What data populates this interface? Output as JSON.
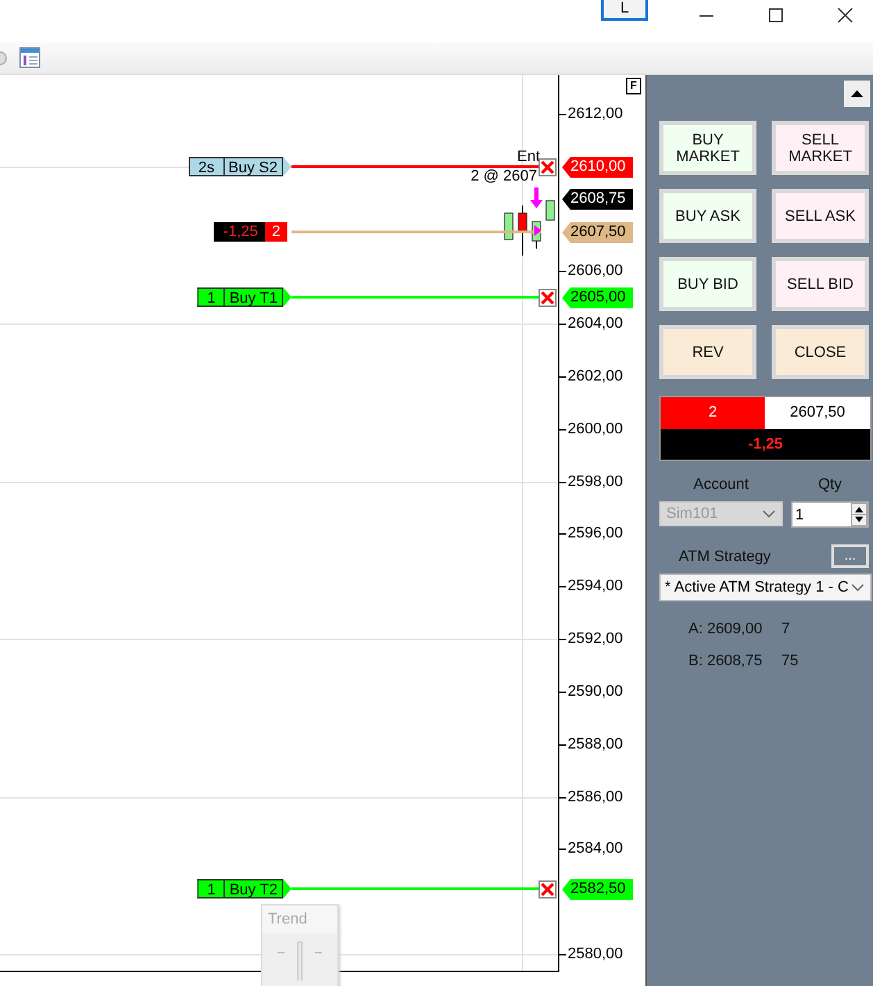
{
  "title_bar": {
    "badge": "L"
  },
  "chart": {
    "flag": "F",
    "price_axis": [
      "2612,00",
      "2606,00",
      "2604,00",
      "2602,00",
      "2600,00",
      "2598,00",
      "2596,00",
      "2594,00",
      "2592,00",
      "2590,00",
      "2588,00",
      "2586,00",
      "2584,00",
      "2580,00"
    ],
    "orders": [
      {
        "kind": "stop",
        "quantity": "2s",
        "label": "Buy S2",
        "price": "2610,00"
      },
      {
        "kind": "target",
        "quantity": "1",
        "label": "Buy T1",
        "price": "2605,00"
      },
      {
        "kind": "target",
        "quantity": "1",
        "label": "Buy T2",
        "price": "2582,50"
      }
    ],
    "entry_marker": {
      "title": "Ent",
      "detail": "2 @ 2607"
    },
    "last_price": "2608,75",
    "position": {
      "pnl": "-1,25",
      "quantity": "2",
      "price": "2607,50"
    },
    "trend_panel": {
      "title": "Trend"
    }
  },
  "panel": {
    "buttons": [
      {
        "kind": "buy",
        "label": "BUY MARKET"
      },
      {
        "kind": "sell",
        "label": "SELL MARKET"
      },
      {
        "kind": "buy",
        "label": "BUY ASK"
      },
      {
        "kind": "sell",
        "label": "SELL ASK"
      },
      {
        "kind": "buy",
        "label": "BUY BID"
      },
      {
        "kind": "sell",
        "label": "SELL BID"
      },
      {
        "kind": "neutral",
        "label": "REV"
      },
      {
        "kind": "neutral",
        "label": "CLOSE"
      }
    ],
    "position": {
      "quantity": "2",
      "avg_price": "2607,50",
      "pnl": "-1,25"
    },
    "account": {
      "label": "Account",
      "value": "Sim101",
      "disabled": true
    },
    "qty": {
      "label": "Qty",
      "value": "1"
    },
    "atm": {
      "label": "ATM Strategy",
      "button": "...",
      "value": "* Active ATM Strategy 1 - C"
    },
    "quotes": [
      {
        "label": "A: 2609,00",
        "size": "7"
      },
      {
        "label": "B: 2608,75",
        "size": "75"
      }
    ]
  }
}
